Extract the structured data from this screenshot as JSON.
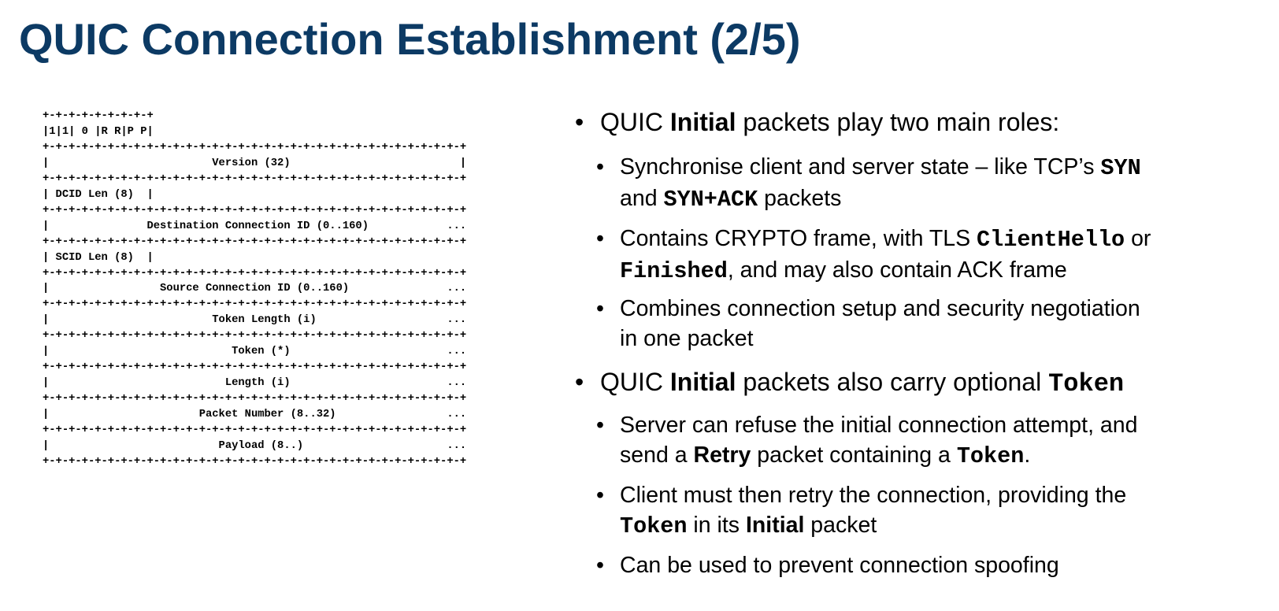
{
  "title": "QUIC Connection Establishment (2/5)",
  "colors": {
    "title": "#0c3a64",
    "text": "#000000",
    "background": "#ffffff"
  },
  "header_diagram": {
    "lines": [
      "+-+-+-+-+-+-+-+-+",
      "|1|1| 0 |R R|P P|",
      "+-+-+-+-+-+-+-+-+-+-+-+-+-+-+-+-+-+-+-+-+-+-+-+-+-+-+-+-+-+-+-+-+",
      "|                         Version (32)                          |",
      "+-+-+-+-+-+-+-+-+-+-+-+-+-+-+-+-+-+-+-+-+-+-+-+-+-+-+-+-+-+-+-+-+",
      "| DCID Len (8)  |",
      "+-+-+-+-+-+-+-+-+-+-+-+-+-+-+-+-+-+-+-+-+-+-+-+-+-+-+-+-+-+-+-+-+",
      "|               Destination Connection ID (0..160)            ...",
      "+-+-+-+-+-+-+-+-+-+-+-+-+-+-+-+-+-+-+-+-+-+-+-+-+-+-+-+-+-+-+-+-+",
      "| SCID Len (8)  |",
      "+-+-+-+-+-+-+-+-+-+-+-+-+-+-+-+-+-+-+-+-+-+-+-+-+-+-+-+-+-+-+-+-+",
      "|                 Source Connection ID (0..160)               ...",
      "+-+-+-+-+-+-+-+-+-+-+-+-+-+-+-+-+-+-+-+-+-+-+-+-+-+-+-+-+-+-+-+-+",
      "|                         Token Length (i)                    ...",
      "+-+-+-+-+-+-+-+-+-+-+-+-+-+-+-+-+-+-+-+-+-+-+-+-+-+-+-+-+-+-+-+-+",
      "|                            Token (*)                        ...",
      "+-+-+-+-+-+-+-+-+-+-+-+-+-+-+-+-+-+-+-+-+-+-+-+-+-+-+-+-+-+-+-+-+",
      "|                           Length (i)                        ...",
      "+-+-+-+-+-+-+-+-+-+-+-+-+-+-+-+-+-+-+-+-+-+-+-+-+-+-+-+-+-+-+-+-+",
      "|                       Packet Number (8..32)                 ...",
      "+-+-+-+-+-+-+-+-+-+-+-+-+-+-+-+-+-+-+-+-+-+-+-+-+-+-+-+-+-+-+-+-+",
      "|                          Payload (8..)                      ...",
      "+-+-+-+-+-+-+-+-+-+-+-+-+-+-+-+-+-+-+-+-+-+-+-+-+-+-+-+-+-+-+-+-+"
    ]
  },
  "bullets": [
    {
      "level": 1,
      "lines": [
        [
          {
            "t": "QUIC "
          },
          {
            "t": "Initial",
            "s": "bold"
          },
          {
            "t": " packets play two main roles:"
          }
        ]
      ]
    },
    {
      "level": 2,
      "lines": [
        [
          {
            "t": "Synchronise client and server state – like TCP’s "
          },
          {
            "t": "SYN",
            "s": "code"
          }
        ],
        [
          {
            "t": "and "
          },
          {
            "t": "SYN+ACK",
            "s": "code"
          },
          {
            "t": " packets"
          }
        ]
      ]
    },
    {
      "level": 2,
      "lines": [
        [
          {
            "t": "Contains CRYPTO frame, with TLS "
          },
          {
            "t": "ClientHello",
            "s": "code"
          },
          {
            "t": " or"
          }
        ],
        [
          {
            "t": "Finished",
            "s": "code"
          },
          {
            "t": ", and may also contain ACK frame"
          }
        ]
      ]
    },
    {
      "level": 2,
      "lines": [
        [
          {
            "t": "Combines connection setup and security negotiation"
          }
        ],
        [
          {
            "t": "in one packet"
          }
        ]
      ]
    },
    {
      "level": 1,
      "lines": [
        [
          {
            "t": "QUIC "
          },
          {
            "t": "Initial",
            "s": "bold"
          },
          {
            "t": " packets also carry optional "
          },
          {
            "t": "Token",
            "s": "code"
          }
        ]
      ]
    },
    {
      "level": 2,
      "lines": [
        [
          {
            "t": "Server can refuse the initial connection attempt, and"
          }
        ],
        [
          {
            "t": "send a "
          },
          {
            "t": "Retry",
            "s": "bold"
          },
          {
            "t": " packet containing a "
          },
          {
            "t": "Token",
            "s": "code"
          },
          {
            "t": "."
          }
        ]
      ]
    },
    {
      "level": 2,
      "lines": [
        [
          {
            "t": "Client must then retry the connection, providing the"
          }
        ],
        [
          {
            "t": "Token",
            "s": "code"
          },
          {
            "t": " in its "
          },
          {
            "t": "Initial",
            "s": "bold"
          },
          {
            "t": " packet"
          }
        ]
      ]
    },
    {
      "level": 2,
      "lines": [
        [
          {
            "t": "Can be used to prevent connection spoofing"
          }
        ]
      ]
    }
  ]
}
